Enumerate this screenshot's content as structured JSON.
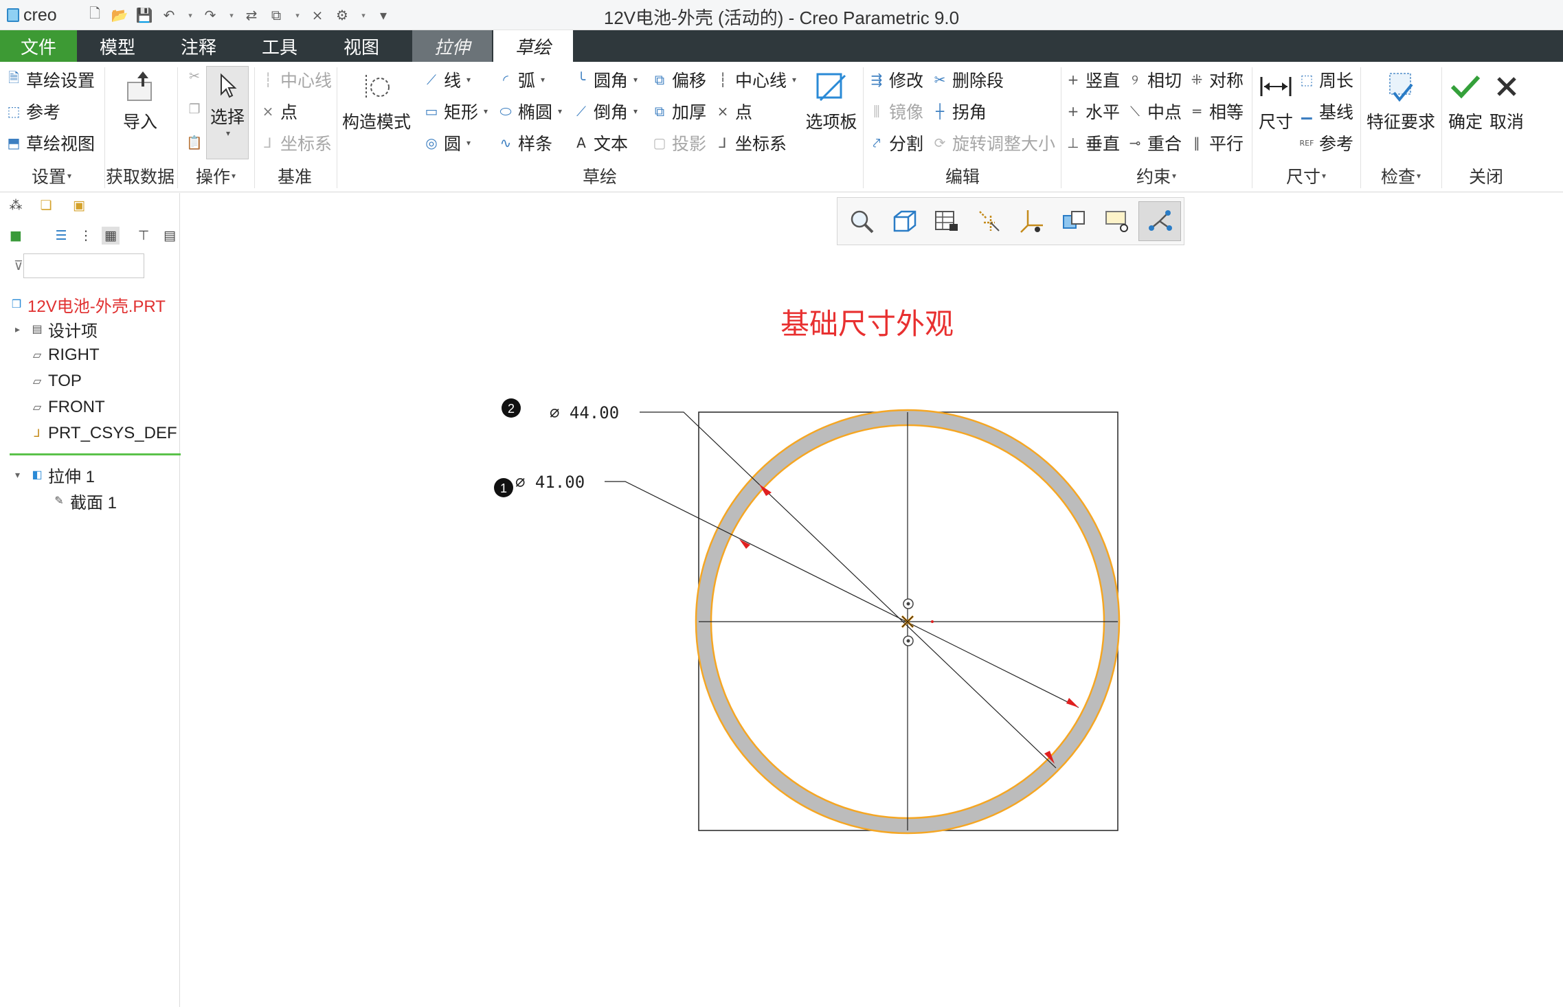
{
  "titlebar": {
    "app_logo": "creo",
    "window_title": "12V电池-外壳 (活动的) - Creo Parametric 9.0",
    "quick_access": [
      "new-icon",
      "open-icon",
      "save-icon",
      "undo-icon",
      "redo-icon",
      "regenerate-icon",
      "windows-icon",
      "close-window-icon",
      "settings-icon",
      "customize-icon"
    ]
  },
  "tabs": {
    "file": "文件",
    "model": "模型",
    "annotate": "注释",
    "tools": "工具",
    "view": "视图",
    "extrude": "拉伸",
    "sketch": "草绘"
  },
  "ribbon": {
    "setup": {
      "sketch_setup": "草绘设置",
      "references": "参考",
      "sketch_view": "草绘视图",
      "label": "设置"
    },
    "get_data": {
      "import": "导入",
      "label": "获取数据"
    },
    "operations": {
      "select": "选择",
      "label": "操作"
    },
    "datum": {
      "centerline": "中心线",
      "point": "点",
      "csys": "坐标系",
      "label": "基准"
    },
    "construction": {
      "mode": "构造模式"
    },
    "sketching": {
      "line": "线",
      "rectangle": "矩形",
      "circle": "圆",
      "arc": "弧",
      "ellipse": "椭圆",
      "spline": "样条",
      "fillet": "圆角",
      "chamfer": "倒角",
      "text": "文本",
      "offset": "偏移",
      "thicken": "加厚",
      "project": "投影",
      "centerline": "中心线",
      "point": "点",
      "csys": "坐标系",
      "palette": "选项板",
      "label": "草绘"
    },
    "editing": {
      "modify": "修改",
      "delete_segment": "删除段",
      "mirror": "镜像",
      "corner": "拐角",
      "divide": "分割",
      "rotate_resize": "旋转调整大小",
      "label": "编辑"
    },
    "constrain": {
      "vertical": "竖直",
      "tangent": "相切",
      "symmetric": "对称",
      "horizontal": "水平",
      "midpoint": "中点",
      "equal": "相等",
      "perpendicular": "垂直",
      "coincident": "重合",
      "parallel": "平行",
      "label": "约束"
    },
    "dimension": {
      "dimension": "尺寸",
      "perimeter": "周长",
      "baseline": "基线",
      "reference": "参考",
      "label": "尺寸"
    },
    "inspect": {
      "feature_requirements": "特征要求",
      "label": "检查"
    },
    "close": {
      "ok": "确定",
      "cancel": "取消",
      "label": "关闭"
    }
  },
  "model_tree": {
    "search_placeholder": "",
    "items": [
      {
        "label": "12V电池-外壳.PRT",
        "color": "#e03030"
      },
      {
        "label": "设计项"
      },
      {
        "label": "RIGHT"
      },
      {
        "label": "TOP"
      },
      {
        "label": "FRONT"
      },
      {
        "label": "PRT_CSYS_DEF"
      },
      {
        "label": "拉伸 1"
      },
      {
        "label": "截面 1"
      }
    ]
  },
  "sketch": {
    "heading": "基础尺寸外观",
    "heading_color": "#e83030",
    "dim_outer": "∅  44.00",
    "dim_inner": "∅  41.00",
    "callout_outer": "2",
    "callout_inner": "1",
    "ring_fill_color": "#bcbcbc",
    "ring_edge_color": "#f5a623",
    "arrow_color": "#e02020",
    "outer_diameter": 44.0,
    "inner_diameter": 41.0
  },
  "colors": {
    "file_tab": "#3d9a34",
    "tabbar": "#2f383c",
    "accent_blue": "#3d7fc1"
  }
}
